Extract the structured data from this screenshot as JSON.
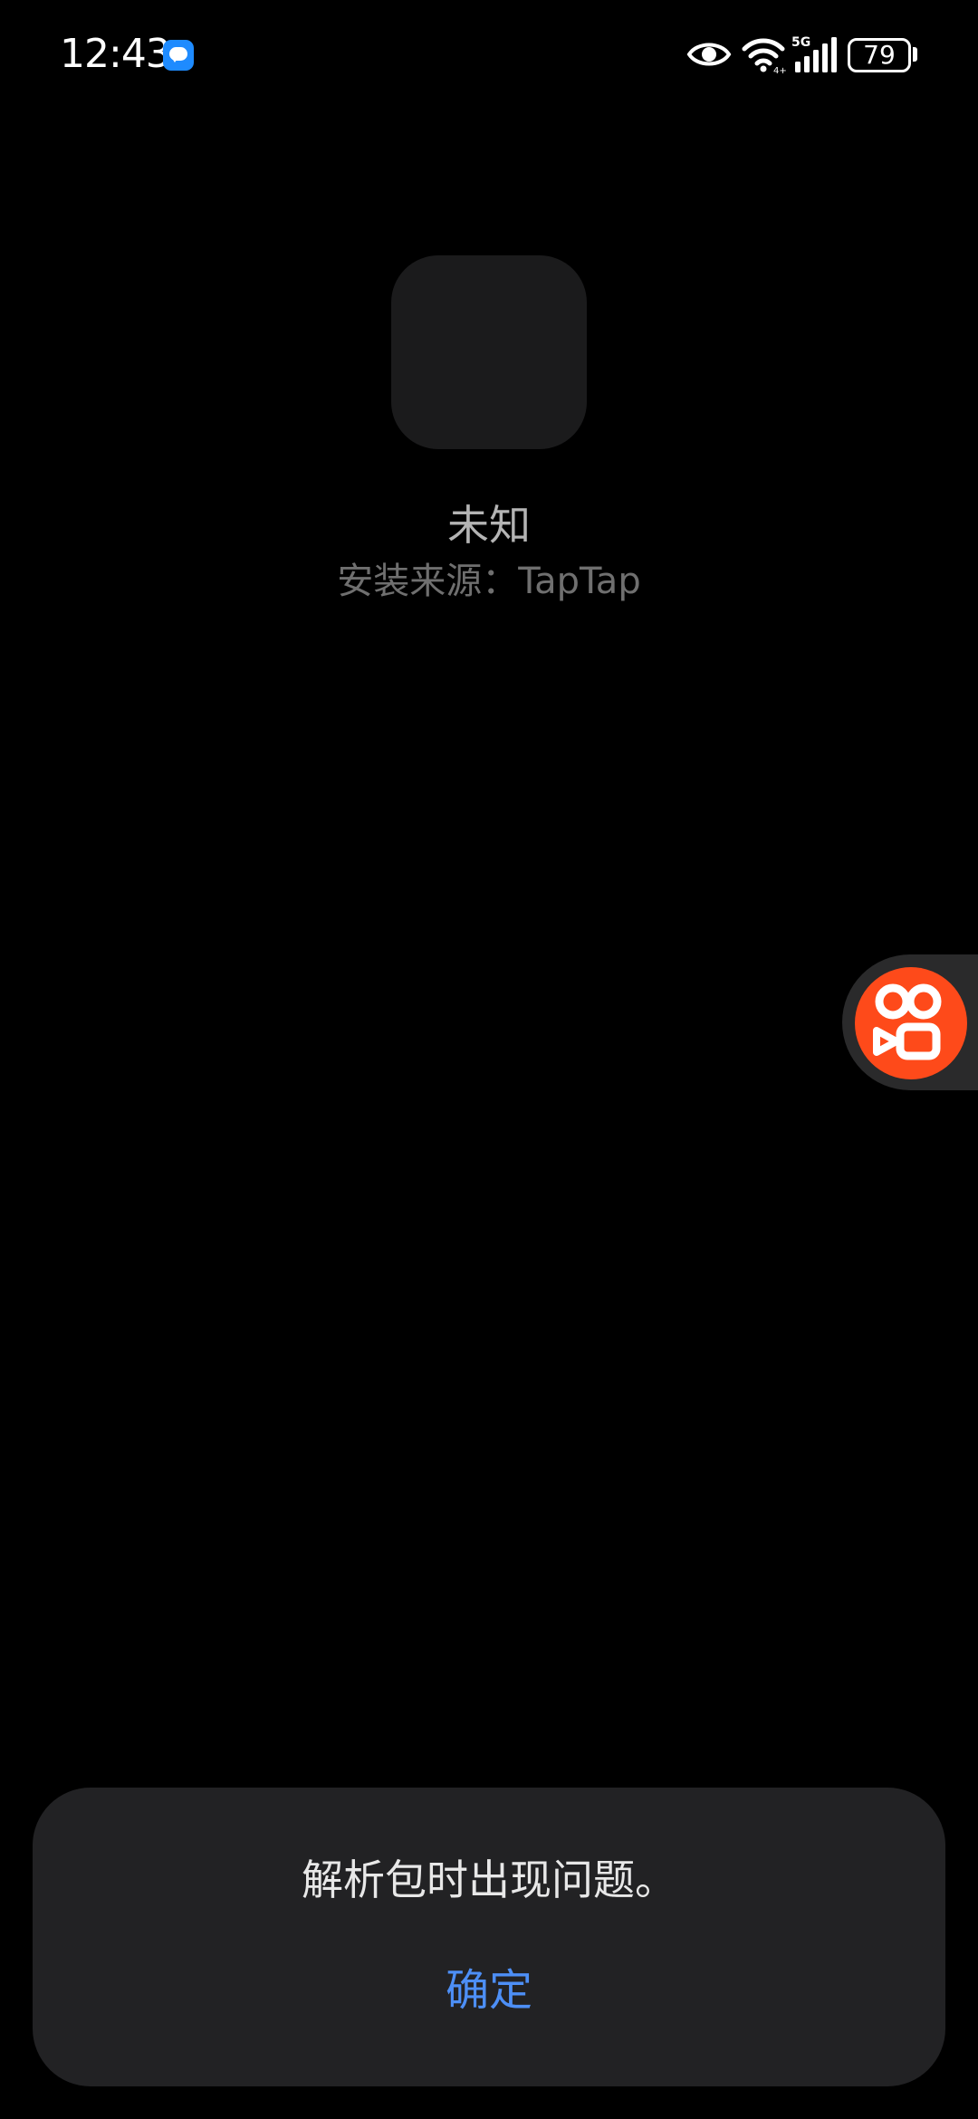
{
  "status_bar": {
    "time": "12:43",
    "battery_level": "79",
    "network": "5G",
    "icons": [
      "message-icon",
      "eye-icon",
      "wifi-icon",
      "signal-icon",
      "battery-icon"
    ]
  },
  "app": {
    "name": "未知",
    "install_source": "安装来源：TapTap"
  },
  "floating_button": {
    "icon": "kuaishou-icon",
    "color": "#fe4a1a"
  },
  "dialog": {
    "message": "解析包时出现问题。",
    "confirm_label": "确定",
    "confirm_color": "#4d8ff6"
  }
}
